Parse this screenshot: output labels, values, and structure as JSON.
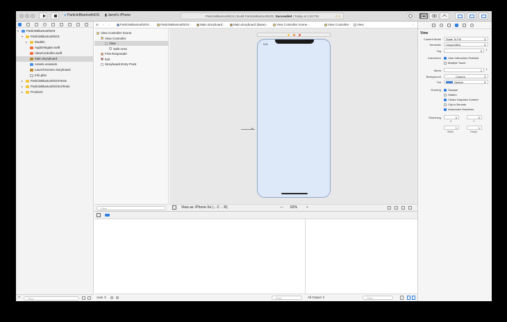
{
  "toolbar": {
    "scheme": "ParticleBluetoothiOS",
    "device": "Jared's iPhone",
    "activity_app": "ParticleBluetoothiOS",
    "activity_status_prefix": "Build ParticleBluetoothiOS:",
    "activity_status_result": "Succeeded",
    "activity_time": "Today at 1:52 PM",
    "warning_count": "1"
  },
  "navigator": {
    "items": [
      {
        "label": "ParticleBluetoothiOS",
        "icon": "blue-project-icon",
        "depth": 0,
        "expanded": true
      },
      {
        "label": "ParticleBluetoothiOS",
        "icon": "yellow-folder-icon",
        "depth": 1,
        "expanded": true
      },
      {
        "label": "Models",
        "icon": "yellow-folder-icon",
        "depth": 2,
        "expanded": false
      },
      {
        "label": "AppDelegate.swift",
        "icon": "swift-file-icon",
        "depth": 2
      },
      {
        "label": "ViewController.swift",
        "icon": "swift-file-icon",
        "depth": 2
      },
      {
        "label": "Main.storyboard",
        "icon": "storyboard-file-icon",
        "depth": 2,
        "selected": true
      },
      {
        "label": "Assets.xcassets",
        "icon": "assets-icon",
        "depth": 2
      },
      {
        "label": "LaunchScreen.storyboard",
        "icon": "storyboard-file-icon",
        "depth": 2
      },
      {
        "label": "Info.plist",
        "icon": "plist-icon",
        "depth": 2
      },
      {
        "label": "ParticleBluetoothiOSTests",
        "icon": "yellow-folder-icon",
        "depth": 1,
        "expanded": false
      },
      {
        "label": "ParticleBluetoothiOSUITests",
        "icon": "yellow-folder-icon",
        "depth": 1,
        "expanded": false
      },
      {
        "label": "Products",
        "icon": "yellow-folder-icon",
        "depth": 1,
        "expanded": false
      }
    ],
    "filter_placeholder": "Filter"
  },
  "jumpbar": {
    "crumbs": [
      "ParticleBluetoothiOS",
      "ParticleBluetoothiOS",
      "Main.storyboard",
      "Main.storyboard (Base)",
      "View Controller Scene",
      "View Controller",
      "View"
    ]
  },
  "outline": {
    "items": [
      {
        "label": "View Controller Scene",
        "depth": 0
      },
      {
        "label": "View Controller",
        "depth": 1
      },
      {
        "label": "View",
        "depth": 2,
        "selected": true
      },
      {
        "label": "Safe Area",
        "depth": 3
      },
      {
        "label": "First Responder",
        "depth": 1
      },
      {
        "label": "Exit",
        "depth": 1
      },
      {
        "label": "Storyboard Entry Point",
        "depth": 1
      }
    ],
    "filter_placeholder": "Filter"
  },
  "canvas": {
    "status_time": "9:41",
    "view_as": "View as: iPhone Xe (←C ←R)",
    "zoom_minus": "—",
    "zoom": "62%",
    "zoom_plus": "+"
  },
  "debug": {
    "auto_label": "Auto",
    "filter_placeholder": "Filter",
    "output_label": "All Output"
  },
  "inspector": {
    "section": "View",
    "content_mode_label": "Content Mode",
    "content_mode": "Scale To Fill",
    "semantic_label": "Semantic",
    "semantic": "Unspecified",
    "tag_label": "Tag",
    "tag": "0",
    "interaction_label": "Interaction",
    "user_interaction": "User Interaction Enabled",
    "multiple_touch": "Multiple Touch",
    "alpha_label": "Alpha",
    "alpha": "1",
    "background_label": "Background",
    "background": "Custom",
    "tint_label": "Tint",
    "tint": "Default",
    "drawing_label": "Drawing",
    "opaque": "Opaque",
    "hidden": "Hidden",
    "clears": "Clears Graphics Context",
    "clip": "Clip to Bounds",
    "autoresize": "Autoresize Subviews",
    "stretching_label": "Stretching",
    "stretch_x": "0",
    "stretch_y": "0",
    "stretch_w": "1",
    "stretch_h": "1",
    "x_label": "X",
    "y_label": "Y",
    "width_label": "Width",
    "height_label": "Height",
    "tint_color": "#3b7fd6"
  }
}
